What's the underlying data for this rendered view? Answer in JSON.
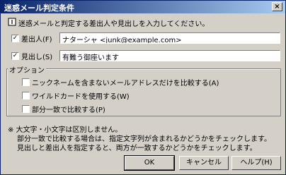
{
  "window": {
    "title": "迷惑メール判定条件",
    "close_glyph": "×"
  },
  "instruction": "迷惑メールと判定する差出人や見出しを入力してください。",
  "sender": {
    "label": "差出人(F)",
    "checked": true,
    "value": "ナターシャ <junk@example.com>"
  },
  "subject": {
    "label": "見出し(S)",
    "checked": true,
    "value": "有難う御座います"
  },
  "options": {
    "legend": "オプション",
    "items": [
      {
        "label": "ニックネームを含まないメールアドレスだけを比較する(A)",
        "checked": false
      },
      {
        "label": "ワイルドカードを使用する(W)",
        "checked": false
      },
      {
        "label": "部分一致で比較する(P)",
        "checked": false
      }
    ]
  },
  "notes": [
    "※ 大文字・小文字は区別しません。",
    "部分一致で比較する場合は、指定文字列が含まれるかどうかをチェックします。",
    "見出しと差出人を指定すると、両方が一致するかどうかをチェックします。"
  ],
  "buttons": {
    "ok": "OK",
    "cancel": "キャンセル",
    "help": "ヘルプ(H)"
  }
}
